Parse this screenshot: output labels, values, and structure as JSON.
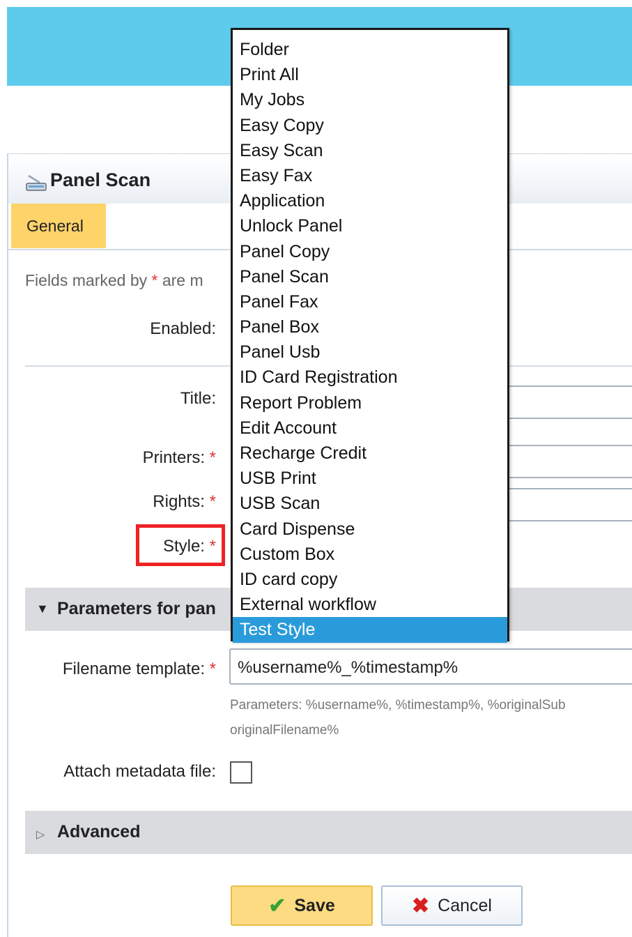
{
  "panel": {
    "title": "Panel Scan",
    "icon": "scanner-icon"
  },
  "tabs": [
    {
      "label": "General",
      "active": true
    }
  ],
  "hint": {
    "text_before": "Fields marked by ",
    "asterisk": "*",
    "text_after": " are m"
  },
  "form": {
    "enabled_label": "Enabled:",
    "title_label": "Title:",
    "printers_label": "Printers:",
    "rights_label": "Rights:",
    "style_label": "Style:",
    "required_mark": "*"
  },
  "sections": {
    "parameters_title": "Parameters for pan",
    "advanced_title": "Advanced"
  },
  "filename": {
    "label": "Filename template:",
    "value": "%username%_%timestamp%",
    "help_line1": "Parameters: %username%, %timestamp%, %originalSub",
    "help_line2": "originalFilename%"
  },
  "metadata": {
    "label": "Attach metadata file:",
    "checked": false
  },
  "buttons": {
    "save_label": "Save",
    "cancel_label": "Cancel"
  },
  "style_dropdown": {
    "options": [
      "Folder",
      "Print All",
      "My Jobs",
      "Easy Copy",
      "Easy Scan",
      "Easy Fax",
      "Application",
      "Unlock Panel",
      "Panel Copy",
      "Panel Scan",
      "Panel Fax",
      "Panel Box",
      "Panel Usb",
      "ID Card Registration",
      "Report Problem",
      "Edit Account",
      "Recharge Credit",
      "USB Print",
      "USB Scan",
      "Card Dispense",
      "Custom Box",
      "ID card copy",
      "External workflow",
      "Test Style"
    ],
    "selected": "Test Style"
  },
  "colors": {
    "top_bar": "#5ecbec",
    "tab_active": "#fdd36a",
    "highlight_border": "#ed2224",
    "selected_option": "#2a9bda",
    "required": "#e03535"
  }
}
